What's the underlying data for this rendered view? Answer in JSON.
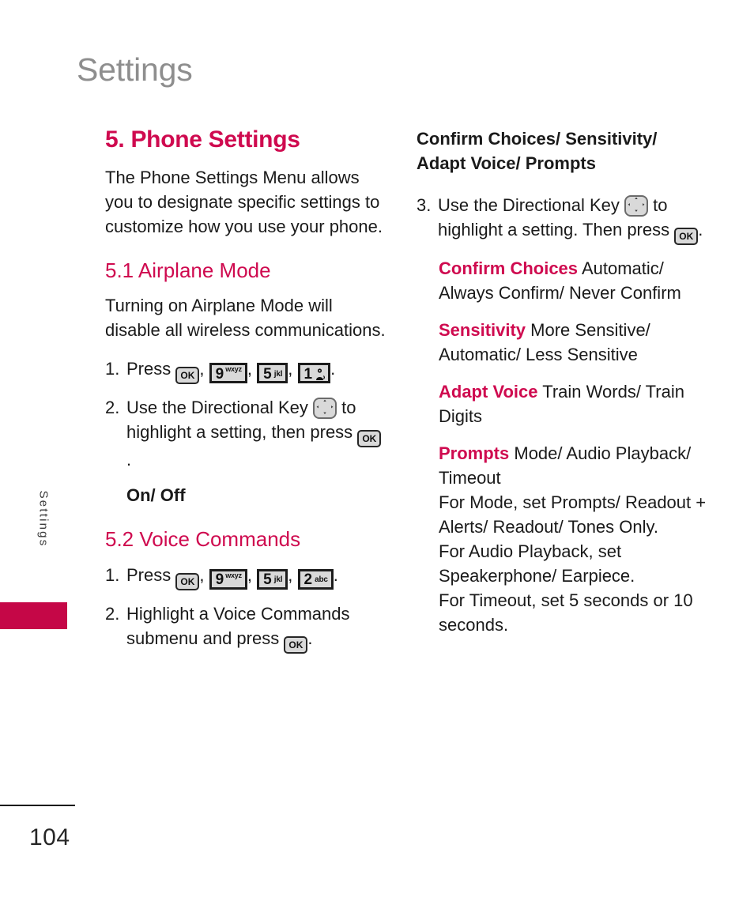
{
  "running_head": "Settings",
  "side_tab": {
    "label": "Settings",
    "color": "#c50747"
  },
  "colors": {
    "accent_pink": "#cf0a4f",
    "tab_pink": "#c50747",
    "running_head_gray": "#8e8e8e",
    "body_text": "#1a1a1a",
    "key_fill": "#d9d9d9",
    "key_border": "#1c1c1c"
  },
  "left_column": {
    "section_heading": "5. Phone Settings",
    "intro": "The Phone Settings Menu allows you to designate specific settings to customize how you use your phone.",
    "subsection_1": {
      "heading": "5.1 Airplane Mode",
      "intro": "Turning on Airplane Mode will disable all wireless communications.",
      "steps": [
        {
          "marker": "1.",
          "pre": "Press",
          "keys": [
            "ok",
            "9wxyz",
            "5jkl",
            "1voicemail"
          ],
          "post": "."
        },
        {
          "marker": "2.",
          "pre": "Use the Directional Key",
          "keys": [
            "dir"
          ],
          "mid": "to highlight a setting, then press",
          "keys2": [
            "ok"
          ],
          "post": "."
        }
      ],
      "options": "On/ Off"
    },
    "subsection_2": {
      "heading": "5.2 Voice Commands",
      "steps": [
        {
          "marker": "1.",
          "pre": "Press",
          "keys": [
            "ok",
            "9wxyz",
            "5jkl",
            "2abc"
          ],
          "post": "."
        },
        {
          "marker": "2.",
          "pre": "Highlight a Voice Commands submenu and press",
          "keys": [
            "ok"
          ],
          "post": "."
        }
      ]
    }
  },
  "right_column": {
    "lead_heading": "Confirm Choices/ Sensitivity/ Adapt Voice/ Prompts",
    "step": {
      "marker": "3.",
      "pre": "Use the Directional Key",
      "mid": "to highlight a setting. Then press",
      "post": "."
    },
    "definitions": [
      {
        "term": "Confirm Choices",
        "values": "Automatic/ Always Confirm/ Never Confirm"
      },
      {
        "term": "Sensitivity",
        "values": "More Sensitive/ Automatic/ Less Sensitive"
      },
      {
        "term": "Adapt Voice",
        "values": "Train Words/ Train Digits"
      },
      {
        "term": "Prompts",
        "values": "Mode/ Audio Playback/ Timeout"
      }
    ],
    "prompts_notes": [
      "For Mode, set Prompts/ Readout + Alerts/ Readout/ Tones Only.",
      "For Audio Playback, set Speakerphone/ Earpiece.",
      "For Timeout, set 5 seconds or 10 seconds."
    ]
  },
  "keys": {
    "ok": {
      "label": "OK"
    },
    "9wxyz": {
      "digit": "9",
      "sup": "wxyz"
    },
    "5jkl": {
      "digit": "5",
      "letters": "jkl"
    },
    "2abc": {
      "digit": "2",
      "letters": "abc"
    },
    "1voicemail": {
      "digit": "1",
      "letters": ""
    },
    "dir": {
      "label": "Directional Key"
    }
  },
  "footer": {
    "page_number": "104"
  }
}
